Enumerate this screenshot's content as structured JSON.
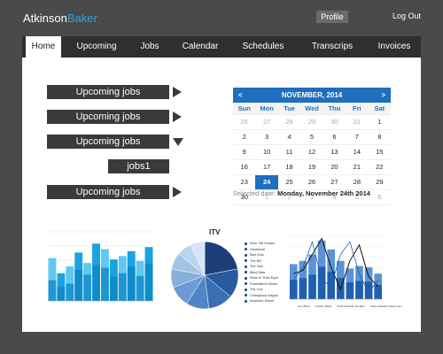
{
  "app": {
    "brand_part1": "Atkinson",
    "brand_part2": "Baker",
    "profile": "Profile",
    "logout": "Log  Out"
  },
  "tabs": [
    "Home",
    "Upcoming",
    "Jobs",
    "Calendar",
    "Schedules",
    "Transcrips",
    "Invoices"
  ],
  "jobs": [
    "Upcoming jobs",
    "Upcoming jobs",
    "Upcoming jobs",
    "jobs1",
    "Upcoming jobs"
  ],
  "calendar": {
    "title": "NOVEMBER, 2014",
    "dows": [
      "Sun",
      "Mon",
      "Tue",
      "Wed",
      "Thu",
      "Fri",
      "Sat"
    ],
    "days": [
      "26",
      "27",
      "28",
      "29",
      "30",
      "31",
      "1",
      "2",
      "3",
      "4",
      "5",
      "6",
      "7",
      "8",
      "9",
      "10",
      "11",
      "12",
      "13",
      "14",
      "15",
      "16",
      "17",
      "18",
      "19",
      "20",
      "21",
      "22",
      "23",
      "24",
      "25",
      "26",
      "27",
      "28",
      "29",
      "30",
      "1",
      "2",
      "3",
      "4",
      "5",
      "6"
    ],
    "muted_days": [
      0,
      1,
      2,
      3,
      4,
      5,
      36,
      37,
      38,
      39,
      40,
      41
    ],
    "selected_index": 29,
    "selected_label": "Selected date:",
    "selected_value": "Monday, November 24th 2014"
  },
  "pie_title": "ITV",
  "legend_items": [
    "Who, Wil Ernaire",
    "Heartbeat",
    "Bad Girls",
    "The Bill",
    "The Vice",
    "Blind Date",
    "Stars In Their Eyes",
    "Footballer's Wives",
    "The Cub",
    "Champions league",
    "Inspector Morse"
  ],
  "line_legend": [
    "Item (Bars)",
    "Industry (Bars)",
    "Clicks (Default) Item Bars",
    "Clicks (Default) Industry Item"
  ],
  "colors": {
    "blue": "#1e6fbd",
    "dark": "#3a3a3a",
    "nav": "#2f2f2f",
    "bg": "#4a4a4a"
  },
  "chart_data": [
    {
      "type": "bar",
      "series": [
        {
          "values": [
            62,
            40,
            50,
            70,
            55,
            83,
            75,
            60,
            65,
            72,
            58,
            78
          ]
        },
        {
          "values": [
            30,
            20,
            25,
            45,
            38,
            52,
            48,
            35,
            40,
            50,
            36,
            54
          ]
        }
      ]
    },
    {
      "type": "pie",
      "values": [
        22,
        14,
        12,
        11,
        10,
        9,
        8,
        7,
        7
      ]
    },
    {
      "type": "bar",
      "series": [
        {
          "values": [
            55,
            60,
            70,
            92,
            78,
            60,
            48,
            52,
            50,
            40
          ]
        }
      ]
    }
  ]
}
